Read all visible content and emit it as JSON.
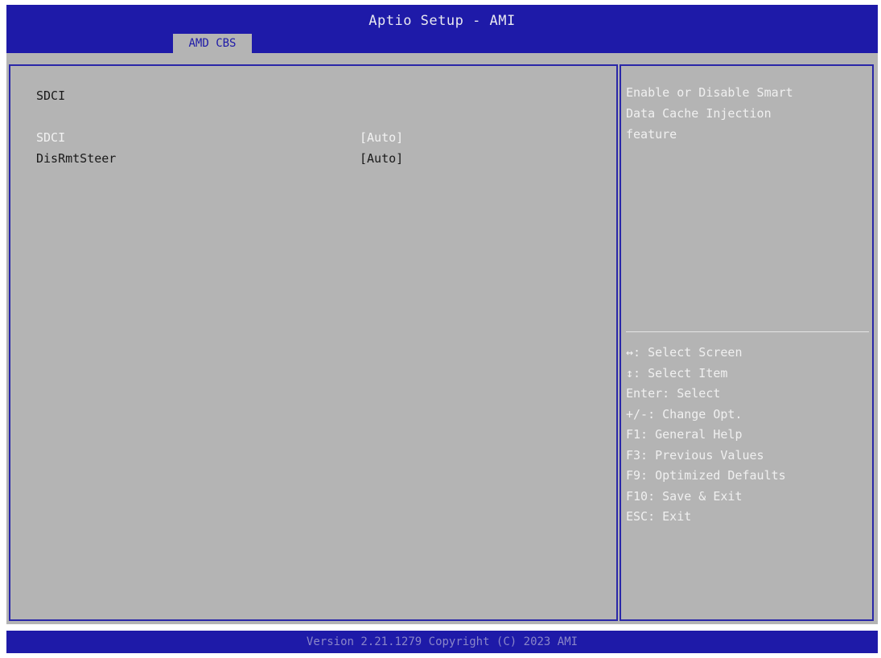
{
  "header": {
    "title": "Aptio Setup - AMI",
    "tab": "AMD CBS"
  },
  "main": {
    "section_title": "SDCI",
    "items": [
      {
        "label": "SDCI",
        "value": "[Auto]"
      },
      {
        "label": "DisRmtSteer",
        "value": "[Auto]"
      }
    ]
  },
  "help": {
    "description_lines": [
      "Enable or Disable Smart",
      "Data Cache Injection",
      "feature"
    ],
    "keys": [
      "↔: Select Screen",
      "↕: Select Item",
      "Enter: Select",
      "+/-: Change Opt.",
      "F1: General Help",
      "F3: Previous Values",
      "F9: Optimized Defaults",
      "F10: Save & Exit",
      "ESC: Exit"
    ]
  },
  "footer": {
    "text": "Version 2.21.1279 Copyright (C) 2023 AMI"
  },
  "colors": {
    "accent": "#1e1aa8",
    "background": "#b4b4b4",
    "highlight": "#f2f2f2"
  }
}
